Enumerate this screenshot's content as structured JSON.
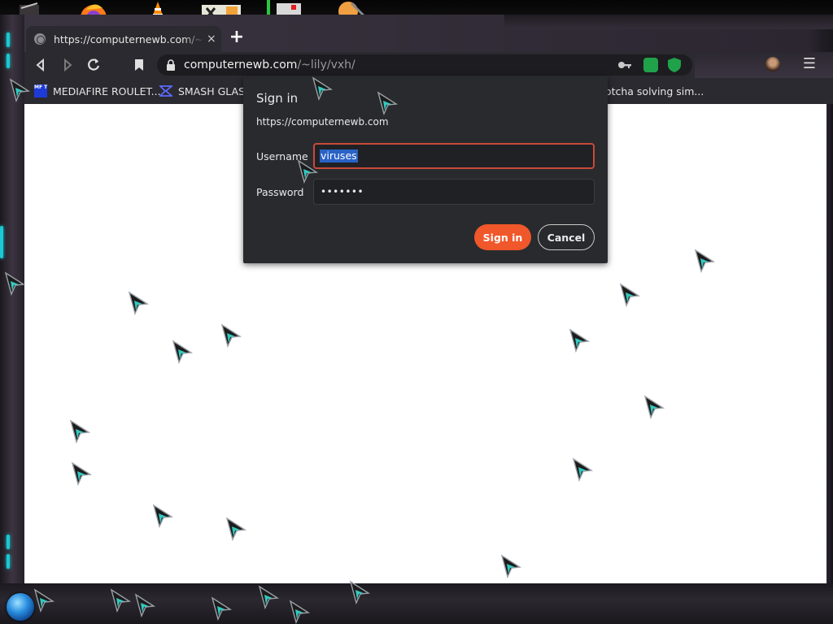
{
  "browser": {
    "tab": {
      "title": "https://computernewb.com/~lily/vxh/",
      "close_glyph": "×"
    },
    "new_tab_glyph": "+",
    "toolbar": {
      "back_glyph": "◁",
      "forward_glyph": "▷",
      "reload_glyph": "↻",
      "url_domain": "computernewb.com",
      "url_path": "/~lily/vxh/",
      "menu_glyph": "☰"
    },
    "bookmarks": [
      {
        "label": "MEDIAFIRE ROULET...",
        "icon": "mediafire-icon",
        "icon_text": "MF T"
      },
      {
        "label": "SMASH GLASS",
        "icon": "smash-glass-icon"
      },
      {
        "label": "aptcha solving sim..."
      }
    ]
  },
  "dialog": {
    "title": "Sign in",
    "origin": "https://computernewb.com",
    "username_label": "Username",
    "username_value": "viruses",
    "password_label": "Password",
    "password_value": "•••••••",
    "sign_in_label": "Sign in",
    "cancel_label": "Cancel"
  },
  "colors": {
    "accent": "#f0572a",
    "frame_cyan": "#19c9d3",
    "dialog_bg": "#292a2d",
    "username_border": "#c84a3c",
    "selection": "#2a62c6"
  }
}
